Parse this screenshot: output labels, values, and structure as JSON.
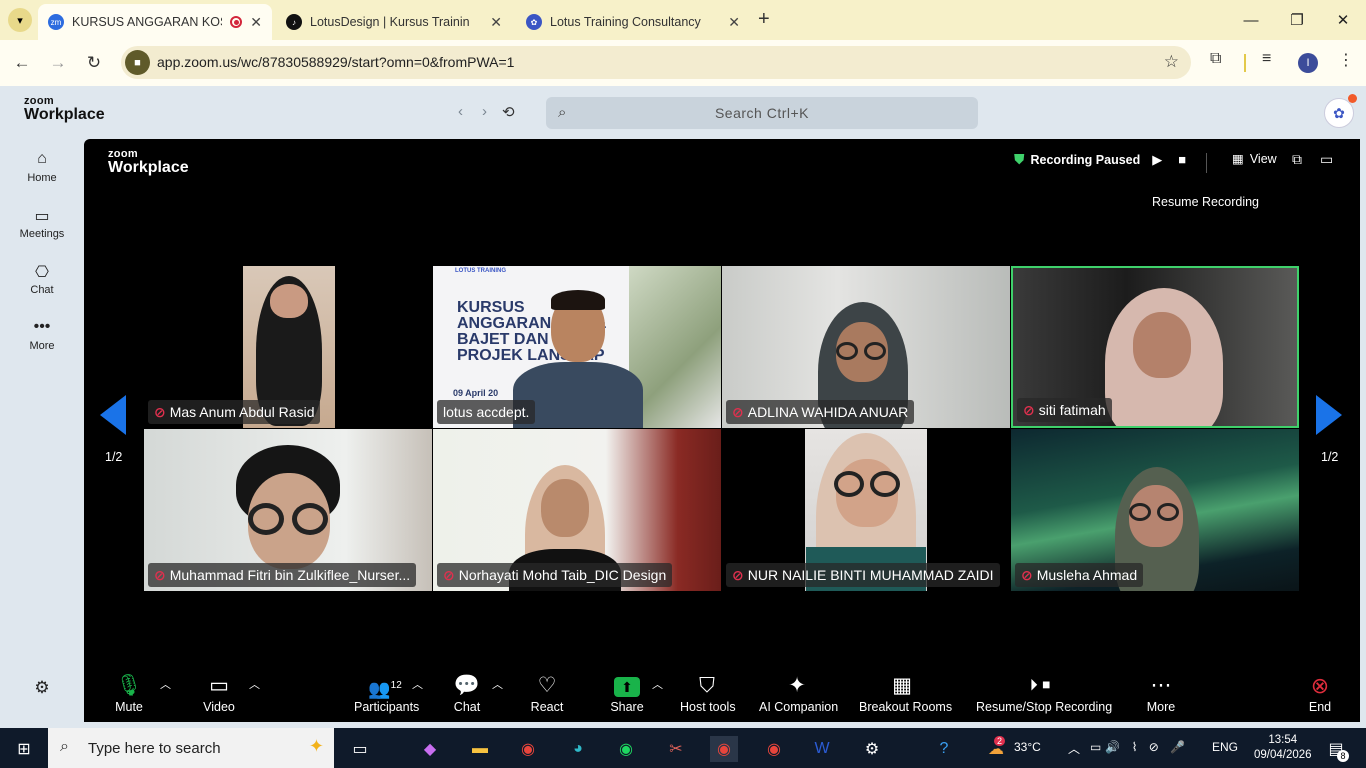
{
  "browser": {
    "tabs": [
      {
        "title": "KURSUS ANGGARAN KOS D",
        "favicon": "zm",
        "active": true
      },
      {
        "title": "LotusDesign | Kursus Training (",
        "favicon": "tiktok-icon",
        "active": false
      },
      {
        "title": "Lotus Training Consultancy",
        "favicon": "lotus-icon",
        "active": false
      }
    ],
    "new_tab": "+",
    "url": "app.zoom.us/wc/87830588929/start?omn=0&fromPWA=1",
    "profile_initial": "I"
  },
  "app": {
    "logo_top": "zoom",
    "logo_bottom": "Workplace",
    "search_placeholder": "Search Ctrl+K"
  },
  "sidebar": {
    "items": [
      {
        "label": "Home",
        "icon": "home-icon"
      },
      {
        "label": "Meetings",
        "icon": "video-icon"
      },
      {
        "label": "Chat",
        "icon": "chat-icon"
      },
      {
        "label": "More",
        "icon": "more-icon"
      }
    ]
  },
  "meeting": {
    "logo_top": "zoom",
    "logo_bottom": "Workplace",
    "recording_status": "Recording Paused",
    "resume_tooltip": "Resume Recording",
    "view_label": "View",
    "page_left": "1/2",
    "page_right": "1/2",
    "participants": [
      {
        "name": "Mas Anum Abdul Rasid",
        "muted": true
      },
      {
        "name": "lotus accdept.",
        "muted": false
      },
      {
        "name": "ADLINA WAHIDA ANUAR",
        "muted": true
      },
      {
        "name": "siti fatimah",
        "muted": true
      },
      {
        "name": "Muhammad Fitri bin Zulkiflee_Nurser...",
        "muted": true
      },
      {
        "name": "Norhayati Mohd Taib_DIC Design",
        "muted": true
      },
      {
        "name": "NUR NAILIE BINTI MUHAMMAD ZAIDI",
        "muted": true
      },
      {
        "name": "Musleha Ahmad",
        "muted": true
      }
    ],
    "slide": {
      "title_lines": [
        "KURSUS",
        "ANGGARAN KOS &",
        "BAJET DAN",
        "PROJEK LANSKAP"
      ],
      "date": "09 April 20",
      "brand": "LOTUS TRAINING"
    }
  },
  "toolbar": {
    "mute": "Mute",
    "video": "Video",
    "participants": "Participants",
    "participants_count": "12",
    "chat": "Chat",
    "react": "React",
    "share": "Share",
    "host_tools": "Host tools",
    "ai_companion": "AI Companion",
    "breakout_rooms": "Breakout Rooms",
    "recording": "Resume/Stop Recording",
    "more": "More",
    "end": "End"
  },
  "taskbar": {
    "search_placeholder": "Type here to search",
    "weather": "33°C",
    "language": "ENG",
    "time": "13:54",
    "date": "09/04/2026",
    "notifications": "8",
    "teams_badge": "2"
  },
  "colors": {
    "share_green": "#19b34a",
    "end_red": "#e02d3c",
    "active_speaker": "#3fd16b",
    "arrow_blue": "#1a73e8"
  }
}
